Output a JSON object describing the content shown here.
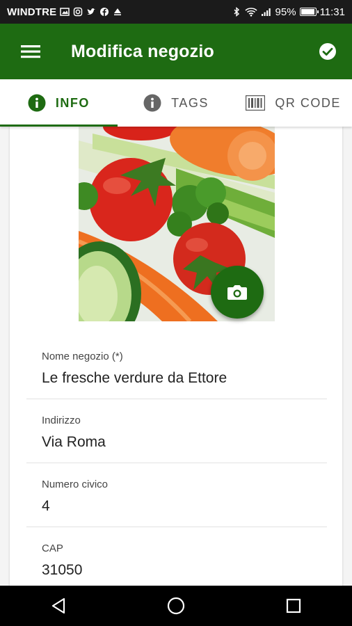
{
  "status_bar": {
    "carrier": "WINDTRE",
    "battery_percent": "95%",
    "battery_level": 0.95,
    "time": "11:31"
  },
  "app_bar": {
    "title": "Modifica negozio",
    "menu_icon": "hamburger-menu-icon",
    "confirm_icon": "check-circle-icon",
    "background_color": "#1e6b12"
  },
  "tabs": [
    {
      "label": "INFO",
      "icon": "info-circle-icon",
      "active": true
    },
    {
      "label": "TAGS",
      "icon": "info-circle-icon",
      "active": false
    },
    {
      "label": "QR CODE",
      "icon": "barcode-icon",
      "active": false
    }
  ],
  "photo": {
    "subject": "vegetables-photo",
    "camera_button_icon": "camera-icon"
  },
  "fields": [
    {
      "label": "Nome negozio (*)",
      "value": "Le fresche verdure da Ettore"
    },
    {
      "label": "Indirizzo",
      "value": "Via Roma"
    },
    {
      "label": "Numero civico",
      "value": "4"
    },
    {
      "label": "CAP",
      "value": "31050"
    }
  ],
  "nav_bar": {
    "back_icon": "back-triangle-icon",
    "home_icon": "home-circle-icon",
    "recents_icon": "recents-square-icon"
  },
  "colors": {
    "accent": "#1e6b12",
    "status_bar": "#1b1b1b",
    "nav_bar": "#000000"
  }
}
